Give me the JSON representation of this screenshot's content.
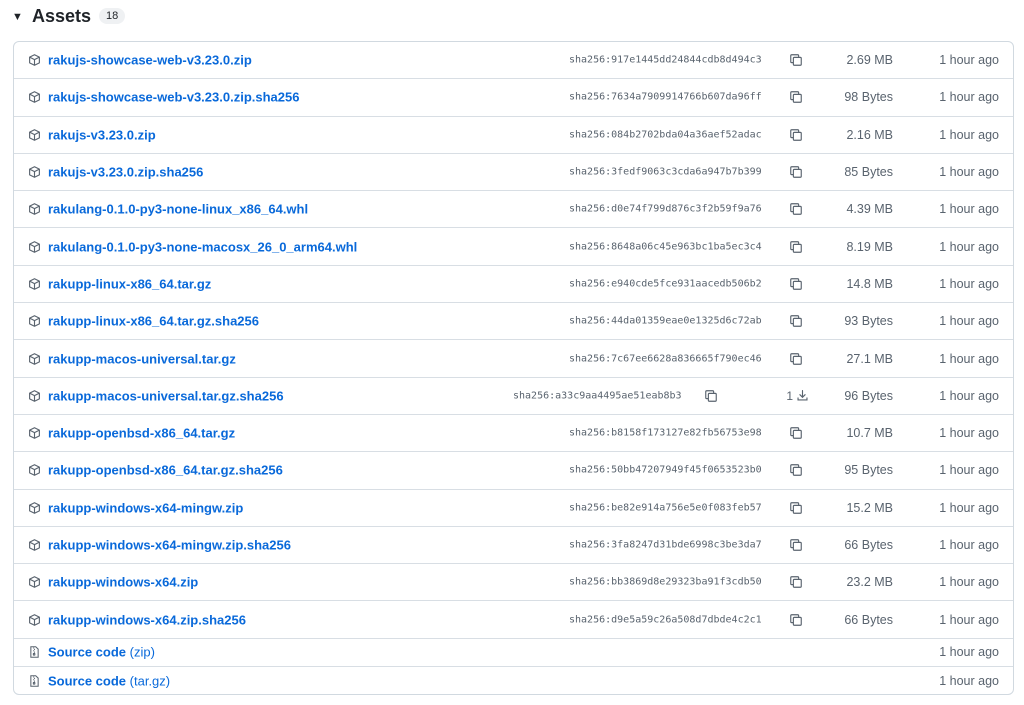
{
  "section": {
    "title": "Assets",
    "count": "18"
  },
  "assets": [
    {
      "name": "rakujs-showcase-web-v3.23.0.zip",
      "sha": "sha256:917e1445dd24844cdb8d494c3",
      "size": "2.69 MB",
      "time": "1 hour ago"
    },
    {
      "name": "rakujs-showcase-web-v3.23.0.zip.sha256",
      "sha": "sha256:7634a7909914766b607da96ff",
      "size": "98 Bytes",
      "time": "1 hour ago"
    },
    {
      "name": "rakujs-v3.23.0.zip",
      "sha": "sha256:084b2702bda04a36aef52adac",
      "size": "2.16 MB",
      "time": "1 hour ago"
    },
    {
      "name": "rakujs-v3.23.0.zip.sha256",
      "sha": "sha256:3fedf9063c3cda6a947b7b399",
      "size": "85 Bytes",
      "time": "1 hour ago"
    },
    {
      "name": "rakulang-0.1.0-py3-none-linux_x86_64.whl",
      "sha": "sha256:d0e74f799d876c3f2b59f9a76",
      "size": "4.39 MB",
      "time": "1 hour ago"
    },
    {
      "name": "rakulang-0.1.0-py3-none-macosx_26_0_arm64.whl",
      "sha": "sha256:8648a06c45e963bc1ba5ec3c4",
      "size": "8.19 MB",
      "time": "1 hour ago"
    },
    {
      "name": "rakupp-linux-x86_64.tar.gz",
      "sha": "sha256:e940cde5fce931aacedb506b2",
      "size": "14.8 MB",
      "time": "1 hour ago"
    },
    {
      "name": "rakupp-linux-x86_64.tar.gz.sha256",
      "sha": "sha256:44da01359eae0e1325d6c72ab",
      "size": "93 Bytes",
      "time": "1 hour ago"
    },
    {
      "name": "rakupp-macos-universal.tar.gz",
      "sha": "sha256:7c67ee6628a836665f790ec46",
      "size": "27.1 MB",
      "time": "1 hour ago"
    },
    {
      "name": "rakupp-macos-universal.tar.gz.sha256",
      "sha": "sha256:a33c9aa4495ae51eab8b3",
      "downloads": "1",
      "size": "96 Bytes",
      "time": "1 hour ago"
    },
    {
      "name": "rakupp-openbsd-x86_64.tar.gz",
      "sha": "sha256:b8158f173127e82fb56753e98",
      "size": "10.7 MB",
      "time": "1 hour ago"
    },
    {
      "name": "rakupp-openbsd-x86_64.tar.gz.sha256",
      "sha": "sha256:50bb47207949f45f0653523b0",
      "size": "95 Bytes",
      "time": "1 hour ago"
    },
    {
      "name": "rakupp-windows-x64-mingw.zip",
      "sha": "sha256:be82e914a756e5e0f083feb57",
      "size": "15.2 MB",
      "time": "1 hour ago"
    },
    {
      "name": "rakupp-windows-x64-mingw.zip.sha256",
      "sha": "sha256:3fa8247d31bde6998c3be3da7",
      "size": "66 Bytes",
      "time": "1 hour ago"
    },
    {
      "name": "rakupp-windows-x64.zip",
      "sha": "sha256:bb3869d8e29323ba91f3cdb50",
      "size": "23.2 MB",
      "time": "1 hour ago"
    },
    {
      "name": "rakupp-windows-x64.zip.sha256",
      "sha": "sha256:d9e5a59c26a508d7dbde4c2c1",
      "size": "66 Bytes",
      "time": "1 hour ago"
    }
  ],
  "sources": [
    {
      "label": "Source code",
      "format": "(zip)",
      "time": "1 hour ago"
    },
    {
      "label": "Source code",
      "format": "(tar.gz)",
      "time": "1 hour ago"
    }
  ],
  "colors": {
    "link": "#0969da",
    "muted": "#59636e",
    "border": "#d1d9e0"
  },
  "icons": {
    "asset": "package-icon",
    "source": "file-zip-icon",
    "copy": "copy-icon",
    "download": "download-icon"
  }
}
